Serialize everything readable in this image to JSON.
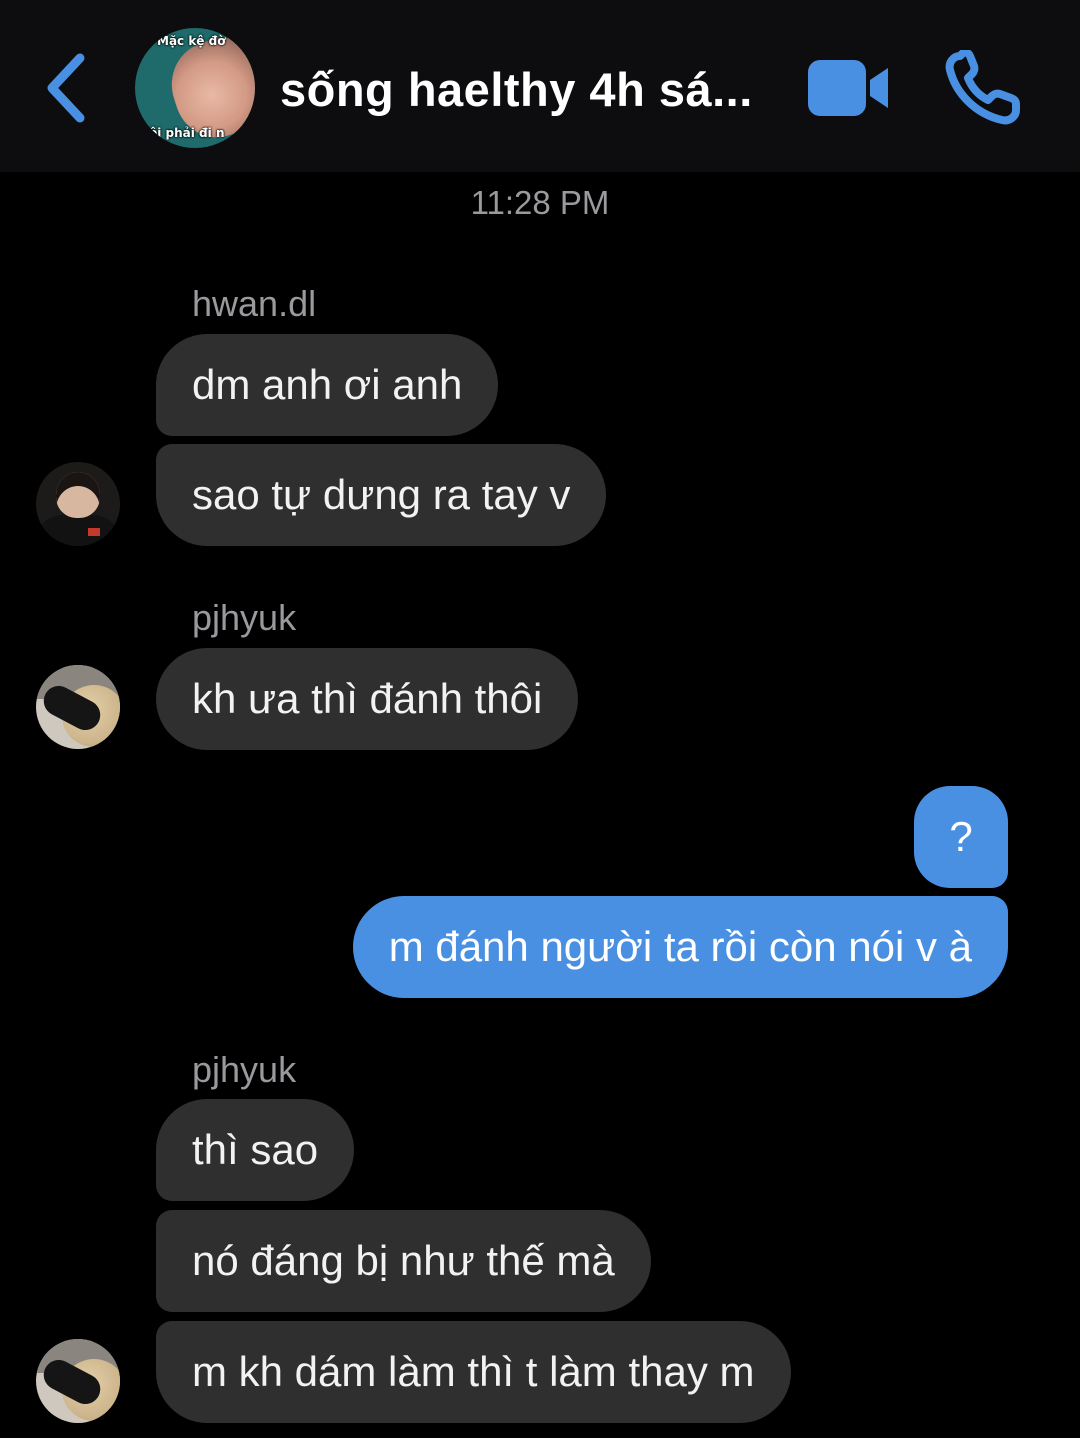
{
  "header": {
    "back_icon": "chevron-left-icon",
    "group_avatar_caption_top": "Mặc kệ đờ",
    "group_avatar_caption_bottom": "ôi phải đi n",
    "title": "sống haelthy 4h sá...",
    "video_icon": "video-camera-icon",
    "call_icon": "phone-icon",
    "accent_color": "#4a90e2"
  },
  "conversation": {
    "timestamp": "11:28 PM",
    "groups": [
      {
        "sender": "hwan.dl",
        "direction": "incoming",
        "messages": [
          "dm anh ơi anh",
          "sao tự dưng ra tay v"
        ]
      },
      {
        "sender": "pjhyuk",
        "direction": "incoming",
        "messages": [
          "kh ưa thì đánh thôi"
        ]
      },
      {
        "sender": "",
        "direction": "outgoing",
        "messages": [
          "?",
          "m đánh người ta rồi còn nói v à"
        ]
      },
      {
        "sender": "pjhyuk",
        "direction": "incoming",
        "messages": [
          "thì sao",
          "nó đáng bị như thế mà",
          "m kh dám làm thì t làm thay m"
        ]
      }
    ]
  },
  "colors": {
    "background": "#000000",
    "header_background": "#0d0d0f",
    "incoming_bubble": "#2f2f2f",
    "outgoing_bubble": "#4a90e2",
    "meta_text": "#9a9a9e"
  }
}
